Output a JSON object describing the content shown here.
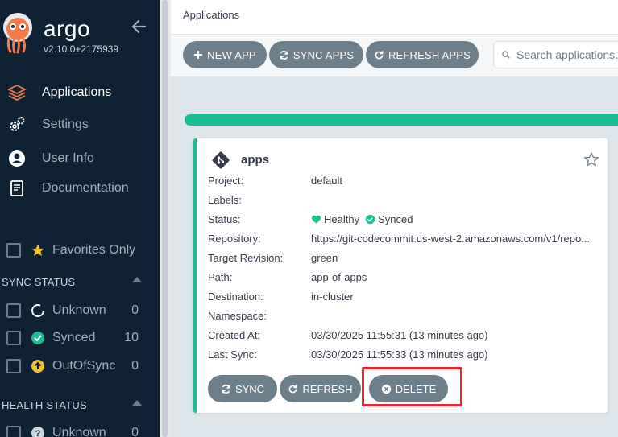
{
  "sidebar": {
    "brand": "argo",
    "version": "v2.10.0+2175939",
    "nav": [
      {
        "label": "Applications",
        "icon": "layers-icon"
      },
      {
        "label": "Settings",
        "icon": "gears-icon"
      },
      {
        "label": "User Info",
        "icon": "user-icon"
      },
      {
        "label": "Documentation",
        "icon": "book-icon"
      }
    ],
    "favorites_label": "Favorites Only",
    "sync_status_header": "SYNC STATUS",
    "sync_status": [
      {
        "label": "Unknown",
        "count": "0"
      },
      {
        "label": "Synced",
        "count": "10"
      },
      {
        "label": "OutOfSync",
        "count": "0"
      }
    ],
    "health_status_header": "HEALTH STATUS",
    "health_status": [
      {
        "label": "Unknown",
        "count": "0"
      }
    ]
  },
  "topbar": {
    "title": "Applications"
  },
  "toolbar": {
    "new_app": "NEW APP",
    "sync_apps": "SYNC APPS",
    "refresh_apps": "REFRESH APPS",
    "search_placeholder": "Search applications..."
  },
  "card": {
    "title": "apps",
    "rows": {
      "project_label": "Project:",
      "project": "default",
      "labels_label": "Labels:",
      "status_label": "Status:",
      "health": "Healthy",
      "sync": "Synced",
      "repo_label": "Repository:",
      "repo": "https://git-codecommit.us-west-2.amazonaws.com/v1/repo...",
      "revision_label": "Target Revision:",
      "revision": "green",
      "path_label": "Path:",
      "path": "app-of-apps",
      "destination_label": "Destination:",
      "destination": "in-cluster",
      "namespace_label": "Namespace:",
      "created_label": "Created At:",
      "created": "03/30/2025 11:55:31  (13 minutes ago)",
      "lastsync_label": "Last Sync:",
      "lastsync": "03/30/2025 11:55:33  (13 minutes ago)"
    },
    "buttons": {
      "sync": "SYNC",
      "refresh": "REFRESH",
      "delete": "DELETE"
    }
  },
  "colors": {
    "sidebar": "#0e2233",
    "accent": "#18be94",
    "button": "#6d7f8b",
    "highlight": "#e8222e"
  }
}
